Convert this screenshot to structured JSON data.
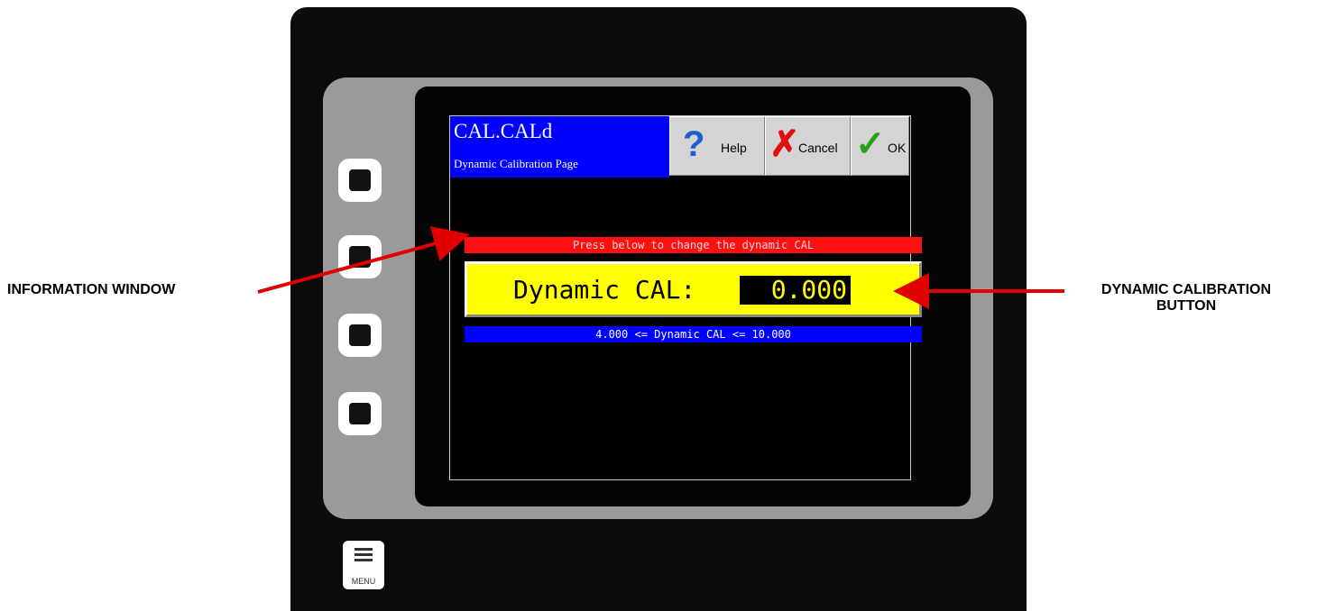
{
  "header": {
    "title": "CAL.CALd",
    "subtitle": "Dynamic Calibration Page"
  },
  "toolbar": {
    "help_label": "Help",
    "cancel_label": "Cancel",
    "ok_label": "OK"
  },
  "info_window": {
    "text": "Press below to change the dynamic CAL"
  },
  "dynamic_cal": {
    "label": "Dynamic CAL:",
    "value": "0.000"
  },
  "range": {
    "text": "4.000 <= Dynamic CAL <= 10.000"
  },
  "menu_key": {
    "label": "MENU"
  },
  "annotations": {
    "left": "INFORMATION WINDOW",
    "right_line1": "DYNAMIC CALIBRATION",
    "right_line2": "BUTTON"
  },
  "colors": {
    "title_bg": "#0000ff",
    "info_bg": "#ff1010",
    "cal_bg": "#ffff00",
    "range_bg": "#0000ff",
    "arrow": "#e00000"
  },
  "icons": [
    "help-question-icon",
    "cancel-x-icon",
    "ok-check-icon",
    "menu-icon"
  ]
}
